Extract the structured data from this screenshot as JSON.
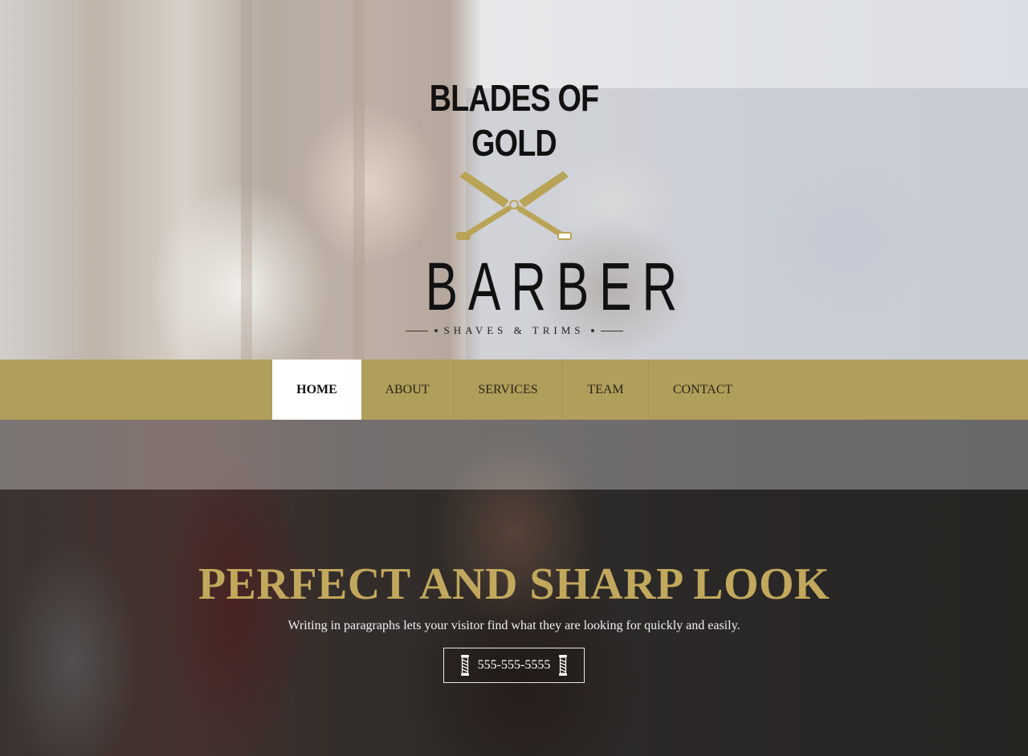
{
  "logo": {
    "top_text": "BLADES OF GOLD",
    "main_text": "BARBER",
    "sub_text": "SHAVES & TRIMS",
    "icon": "crossed-razors-icon",
    "accent_color": "#b9a356"
  },
  "nav": {
    "items": [
      {
        "label": "HOME",
        "active": true
      },
      {
        "label": "ABOUT",
        "active": false
      },
      {
        "label": "SERVICES",
        "active": false
      },
      {
        "label": "TEAM",
        "active": false
      },
      {
        "label": "CONTACT",
        "active": false
      }
    ],
    "bar_color": "#bfab60"
  },
  "hero": {
    "headline": "PERFECT AND SHARP LOOK",
    "subline": "Writing in paragraphs lets your visitor find what they are looking for quickly and easily.",
    "phone": "555-555-5555",
    "phone_icon": "barber-pole-icon",
    "headline_color": "#c2a85c"
  }
}
